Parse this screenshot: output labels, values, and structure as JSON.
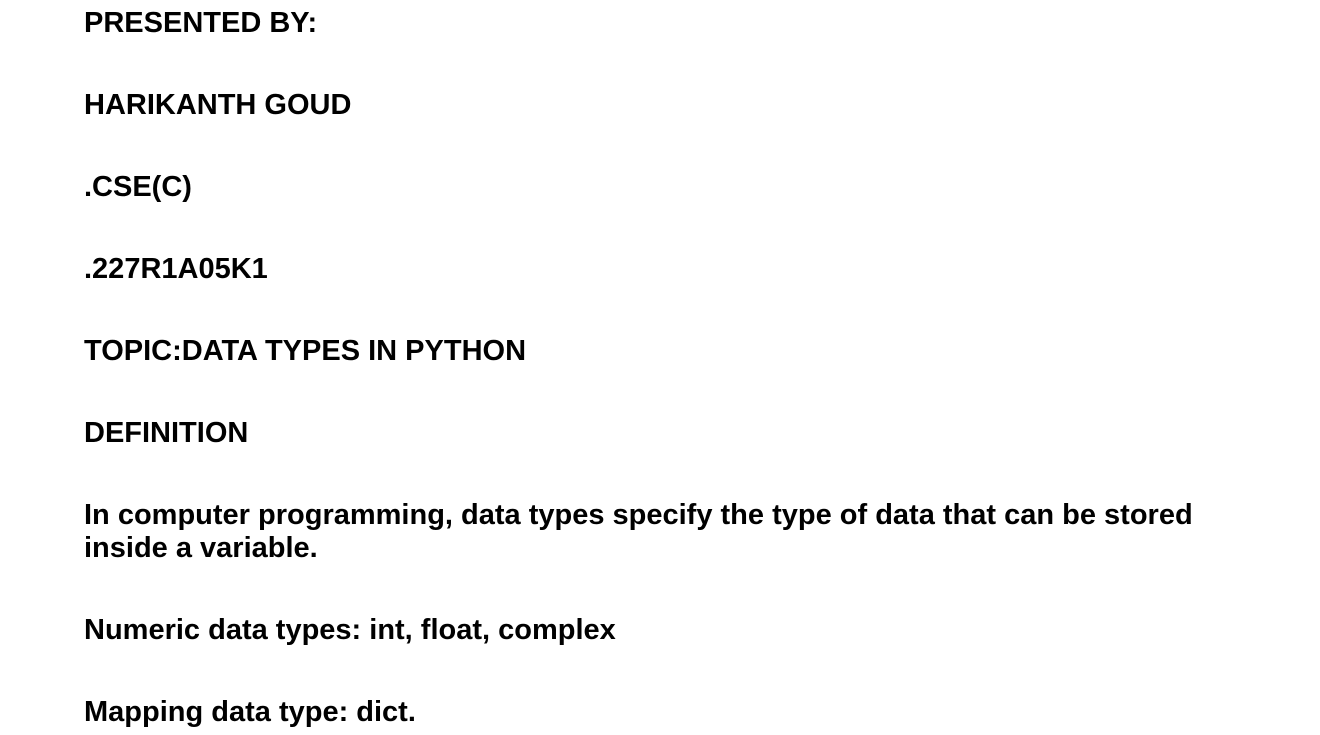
{
  "document": {
    "presented_by": "PRESENTED BY:",
    "name": "HARIKANTH GOUD",
    "section": ".CSE(C)",
    "roll_number": ".227R1A05K1",
    "topic": "TOPIC:DATA TYPES IN PYTHON",
    "definition_heading": "DEFINITION",
    "definition_text": "In computer programming, data types specify the type of data that can be stored inside a variable.",
    "numeric_types": "Numeric data types: int, float, complex",
    "mapping_type": "Mapping data type: dict."
  }
}
